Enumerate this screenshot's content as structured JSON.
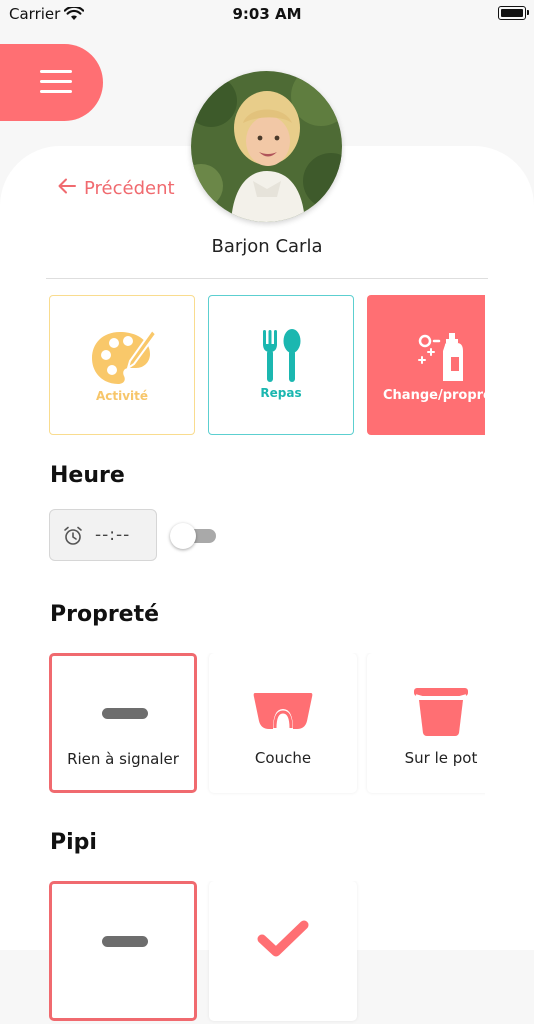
{
  "status_bar": {
    "carrier": "Carrier",
    "time": "9:03 AM"
  },
  "header": {
    "back_label": "Précédent",
    "child_name": "Barjon Carla"
  },
  "categories": [
    {
      "label": "Activité",
      "icon": "palette-icon",
      "color": "#f7c66a"
    },
    {
      "label": "Repas",
      "icon": "fork-spoon-icon",
      "color": "#1bb7b0"
    },
    {
      "label": "Change/propreté",
      "icon": "cleaning-spray-icon",
      "color": "#ff6f73",
      "selected": true
    }
  ],
  "heure": {
    "title": "Heure",
    "value": "--:--",
    "toggle_on": false
  },
  "proprete": {
    "title": "Propreté",
    "options": [
      {
        "label": "Rien à signaler",
        "icon": "dash-icon",
        "selected": true
      },
      {
        "label": "Couche",
        "icon": "diaper-icon",
        "selected": false
      },
      {
        "label": "Sur le pot",
        "icon": "potty-icon",
        "selected": false
      }
    ]
  },
  "pipi": {
    "title": "Pipi",
    "options": [
      {
        "icon": "dash-icon",
        "selected": true
      },
      {
        "icon": "check-icon",
        "selected": false
      }
    ]
  },
  "colors": {
    "accent": "#ff6f73",
    "activite": "#f7c66a",
    "repas": "#1bb7b0"
  }
}
